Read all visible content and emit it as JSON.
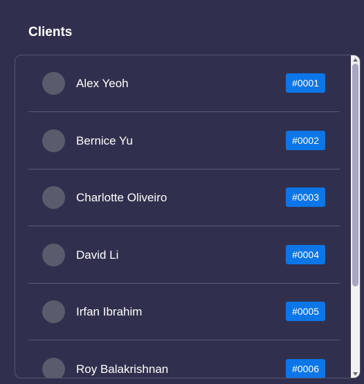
{
  "header": {
    "title": "Clients"
  },
  "clients": [
    {
      "name": "Alex Yeoh",
      "id": "#0001"
    },
    {
      "name": "Bernice Yu",
      "id": "#0002"
    },
    {
      "name": "Charlotte Oliveiro",
      "id": "#0003"
    },
    {
      "name": "David Li",
      "id": "#0004"
    },
    {
      "name": "Irfan Ibrahim",
      "id": "#0005"
    },
    {
      "name": "Roy Balakrishnan",
      "id": "#0006"
    }
  ],
  "colors": {
    "background": "#30304e",
    "badge": "#0c76e8",
    "avatar": "#5a5b6c",
    "scrollbar_thumb": "#a7a5bf"
  }
}
